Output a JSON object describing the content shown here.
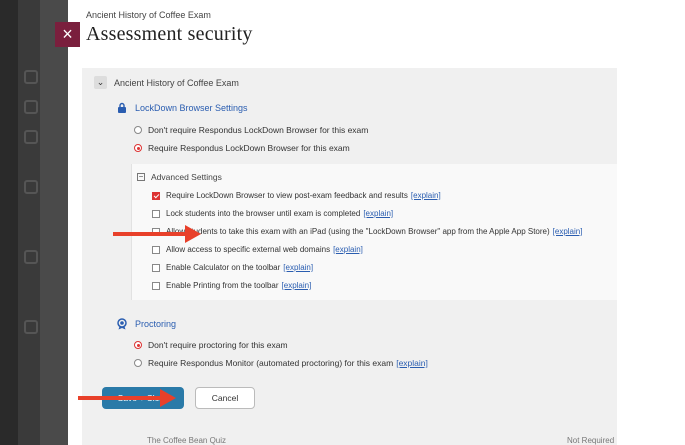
{
  "header": {
    "breadcrumb": "Ancient History of Coffee Exam",
    "title": "Assessment security",
    "close_label": "×"
  },
  "exam_toggle": {
    "chevron": "⌄",
    "label": "Ancient History of Coffee Exam"
  },
  "lockdown": {
    "title": "LockDown Browser Settings",
    "options": [
      {
        "label": "Don't require Respondus LockDown Browser for this exam",
        "selected": false
      },
      {
        "label": "Require Respondus LockDown Browser for this exam",
        "selected": true
      }
    ],
    "advanced": {
      "toggle": "−",
      "title": "Advanced Settings",
      "items": [
        {
          "label": "Require LockDown Browser to view post-exam feedback and results",
          "explain": "[explain]",
          "checked": true
        },
        {
          "label": "Lock students into the browser until exam is completed",
          "explain": "[explain]",
          "checked": false
        },
        {
          "label": "Allow students to take this exam with an iPad (using the \"LockDown Browser\" app from the Apple App Store)",
          "explain": "[explain]",
          "checked": false
        },
        {
          "label": "Allow access to specific external web domains",
          "explain": "[explain]",
          "checked": false
        },
        {
          "label": "Enable Calculator on the toolbar",
          "explain": "[explain]",
          "checked": false
        },
        {
          "label": "Enable Printing from the toolbar",
          "explain": "[explain]",
          "checked": false
        }
      ]
    }
  },
  "proctoring": {
    "title": "Proctoring",
    "options": [
      {
        "label": "Don't require proctoring for this exam",
        "selected": true,
        "explain": ""
      },
      {
        "label": "Require Respondus Monitor (automated proctoring) for this exam",
        "selected": false,
        "explain": "[explain]"
      }
    ]
  },
  "actions": {
    "save_label": "Save + Close",
    "cancel_label": "Cancel"
  },
  "footer": {
    "next_item": "The Coffee Bean Quiz",
    "next_status": "Not Required"
  },
  "colors": {
    "accent": "#2a7aa8",
    "close": "#7a1f3d",
    "link": "#2a5db0",
    "arrow": "#e8402a"
  }
}
